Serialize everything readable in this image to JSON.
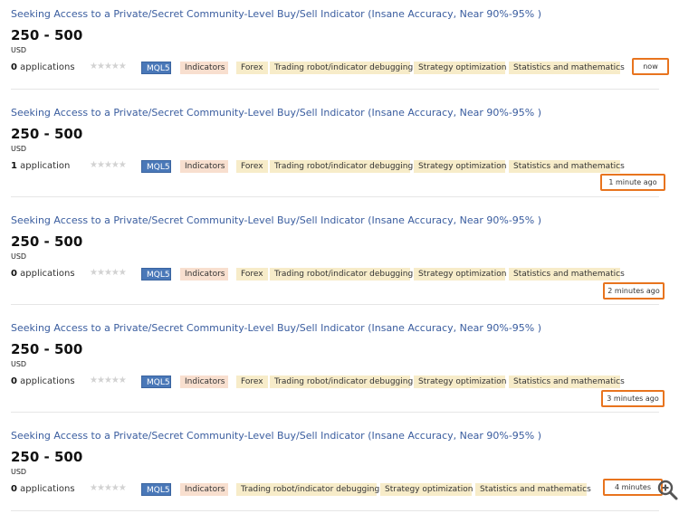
{
  "jobs": [
    {
      "title": "Seeking Access to a Private/Secret Community-Level Buy/Sell Indicator (Insane Accuracy, Near 90%-95% )",
      "price": "250 - 500",
      "currency": "USD",
      "applications_count": "0",
      "applications_label": "applications",
      "tags": [
        "MQL5",
        "Indicators",
        "Forex",
        "Trading robot/indicator debugging",
        "Strategy optimization",
        "Statistics and mathematics"
      ],
      "time": "now"
    },
    {
      "title": "Seeking Access to a Private/Secret Community-Level Buy/Sell Indicator (Insane Accuracy, Near 90%-95% )",
      "price": "250 - 500",
      "currency": "USD",
      "applications_count": "1",
      "applications_label": "application",
      "tags": [
        "MQL5",
        "Indicators",
        "Forex",
        "Trading robot/indicator debugging",
        "Strategy optimization",
        "Statistics and mathematics"
      ],
      "time": "1 minute ago"
    },
    {
      "title": "Seeking Access to a Private/Secret Community-Level Buy/Sell Indicator (Insane Accuracy, Near 90%-95% )",
      "price": "250 - 500",
      "currency": "USD",
      "applications_count": "0",
      "applications_label": "applications",
      "tags": [
        "MQL5",
        "Indicators",
        "Forex",
        "Trading robot/indicator debugging",
        "Strategy optimization",
        "Statistics and mathematics"
      ],
      "time": "2 minutes ago"
    },
    {
      "title": "Seeking Access to a Private/Secret Community-Level Buy/Sell Indicator (Insane Accuracy, Near 90%-95% )",
      "price": "250 - 500",
      "currency": "USD",
      "applications_count": "0",
      "applications_label": "applications",
      "tags": [
        "MQL5",
        "Indicators",
        "Forex",
        "Trading robot/indicator debugging",
        "Strategy optimization",
        "Statistics and mathematics"
      ],
      "time": "3 minutes ago"
    },
    {
      "title": "Seeking Access to a Private/Secret Community-Level Buy/Sell Indicator (Insane Accuracy, Near 90%-95% )",
      "price": "250 - 500",
      "currency": "USD",
      "applications_count": "0",
      "applications_label": "applications",
      "tags": [
        "MQL5",
        "Indicators",
        "Trading robot/indicator debugging",
        "Strategy optimization",
        "Statistics and mathematics"
      ],
      "time": "4 minutes"
    }
  ],
  "stars_rating": 0,
  "stars_max": 5,
  "icons": {
    "zoom": "zoom-in-icon"
  },
  "colors": {
    "title_link": "#3a5d9f",
    "mql5_tag": "#4a78b8",
    "indicators_tag": "#f8dfcf",
    "category_tag": "#f7ecc9",
    "time_highlight": "#e8741e"
  }
}
